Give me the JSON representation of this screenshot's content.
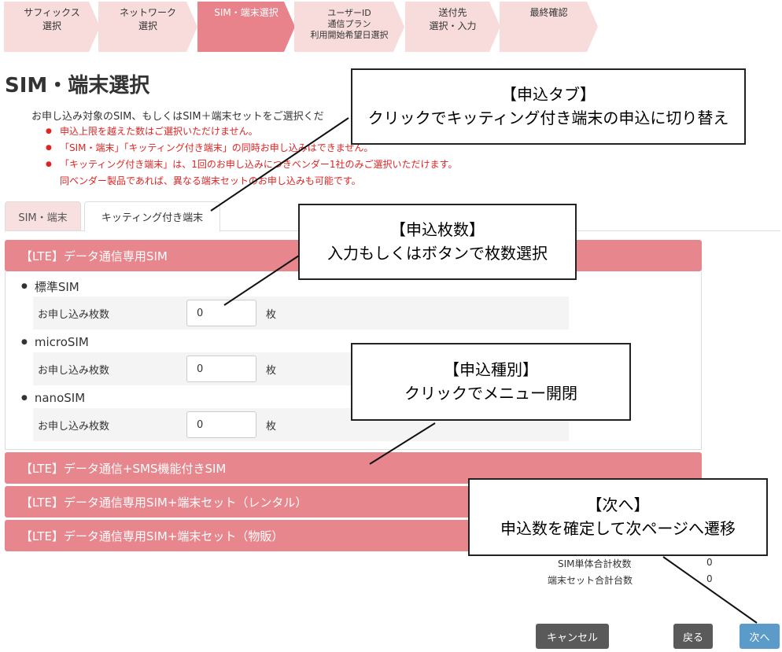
{
  "steps": [
    {
      "label": "サフィックス\n選択",
      "active": false
    },
    {
      "label": "ネットワーク\n選択",
      "active": false
    },
    {
      "label": "SIM・端末選択",
      "active": true
    },
    {
      "label": "ユーザーID\n通信プラン\n利用開始希望日選択",
      "active": false
    },
    {
      "label": "送付先\n選択・入力",
      "active": false
    },
    {
      "label": "最終確認",
      "active": false
    }
  ],
  "page_title": "SIM・端末選択",
  "intro": "お申し込み対象のSIM、もしくはSIM＋端末セットをご選択くだ",
  "notes": [
    "申込上限を越えた数はご選択いただけません。",
    "「SIM・端末」「キッティング付き端末」の同時お申し込みはできません。",
    "「キッティング付き端末」は、1回のお申し込みにつきベンダー1社のみご選択いただけます。"
  ],
  "notes_cont": "同ベンダー製品であれば、異なる端末セットのお申し込みも可能です。",
  "tabs": {
    "sim": "SIM・端末",
    "kitting": "キッティング付き端末"
  },
  "accordion": [
    {
      "title": "【LTE】データ通信専用SIM"
    },
    {
      "title": "【LTE】データ通信+SMS機能付きSIM"
    },
    {
      "title": "【LTE】データ通信専用SIM+端末セット（レンタル）"
    },
    {
      "title": "【LTE】データ通信専用SIM+端末セット（物販）"
    }
  ],
  "sims": [
    {
      "name": "標準SIM",
      "label": "お申し込み枚数",
      "value": "0",
      "unit": "枚"
    },
    {
      "name": "microSIM",
      "label": "お申し込み枚数",
      "value": "0",
      "unit": "枚"
    },
    {
      "name": "nanoSIM",
      "label": "お申し込み枚数",
      "value": "0",
      "unit": "枚"
    }
  ],
  "totals": {
    "sim_label": "SIM単体合計枚数",
    "sim_value": "0",
    "set_label": "端末セット合計台数",
    "set_value": "0"
  },
  "buttons": {
    "cancel": "キャンセル",
    "back": "戻る",
    "next": "次へ"
  },
  "callouts": {
    "tab": {
      "title": "【申込タブ】",
      "text": "クリックでキッティング付き端末の申込に切り替え"
    },
    "qty": {
      "title": "【申込枚数】",
      "text": "入力もしくはボタンで枚数選択"
    },
    "type": {
      "title": "【申込種別】",
      "text": "クリックでメニュー開閉"
    },
    "next": {
      "title": "【次へ】",
      "text": "申込数を確定して次ページへ遷移"
    }
  }
}
